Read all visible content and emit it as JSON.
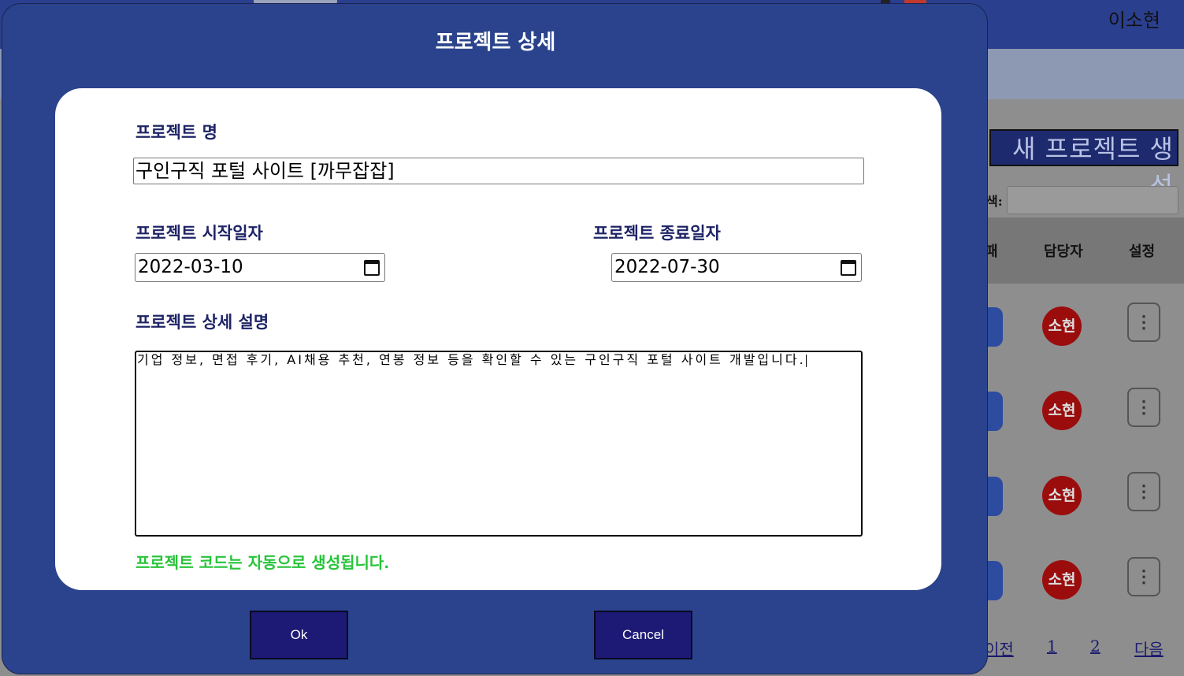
{
  "background": {
    "user_name": "이소현",
    "new_project_button": "새 프로젝트 생성",
    "search_label": "색:",
    "table_headers": [
      "\u0001",
      "담당자",
      "설정"
    ],
    "table_header_partial": "패",
    "rows": [
      {
        "avatar": "소현",
        "menu": "⋮"
      },
      {
        "avatar": "소현",
        "menu": "⋮"
      },
      {
        "avatar": "소현",
        "menu": "⋮"
      },
      {
        "avatar": "소현",
        "menu": "⋮"
      }
    ],
    "pagination": {
      "prev": "이전",
      "pages": [
        "1",
        "2"
      ],
      "next": "다음"
    }
  },
  "modal": {
    "title": "프로젝트 상세",
    "name_label": "프로젝트 명",
    "name_value": "구인구직 포털 사이트 [까무잡잡]",
    "start_label": "프로젝트 시작일자",
    "start_value": "2022-03-10",
    "end_label": "프로젝트 종료일자",
    "end_value": "2022-07-30",
    "desc_label": "프로젝트 상세 설명",
    "desc_value": "기업 정보, 면접 후기, AI채용 추천, 연봉 정보 등을 확인할 수 있는 구인구직 포털 사이트 개발입니다.",
    "notice": "프로젝트 코드는 자동으로 생성됩니다.",
    "ok_label": "Ok",
    "cancel_label": "Cancel"
  },
  "colors": {
    "modal_bg": "#2a438c",
    "button_bg": "#1c1a74",
    "label_text": "#1e2466",
    "notice_text": "#27c43a",
    "avatar_bg": "#9b0d0d"
  }
}
